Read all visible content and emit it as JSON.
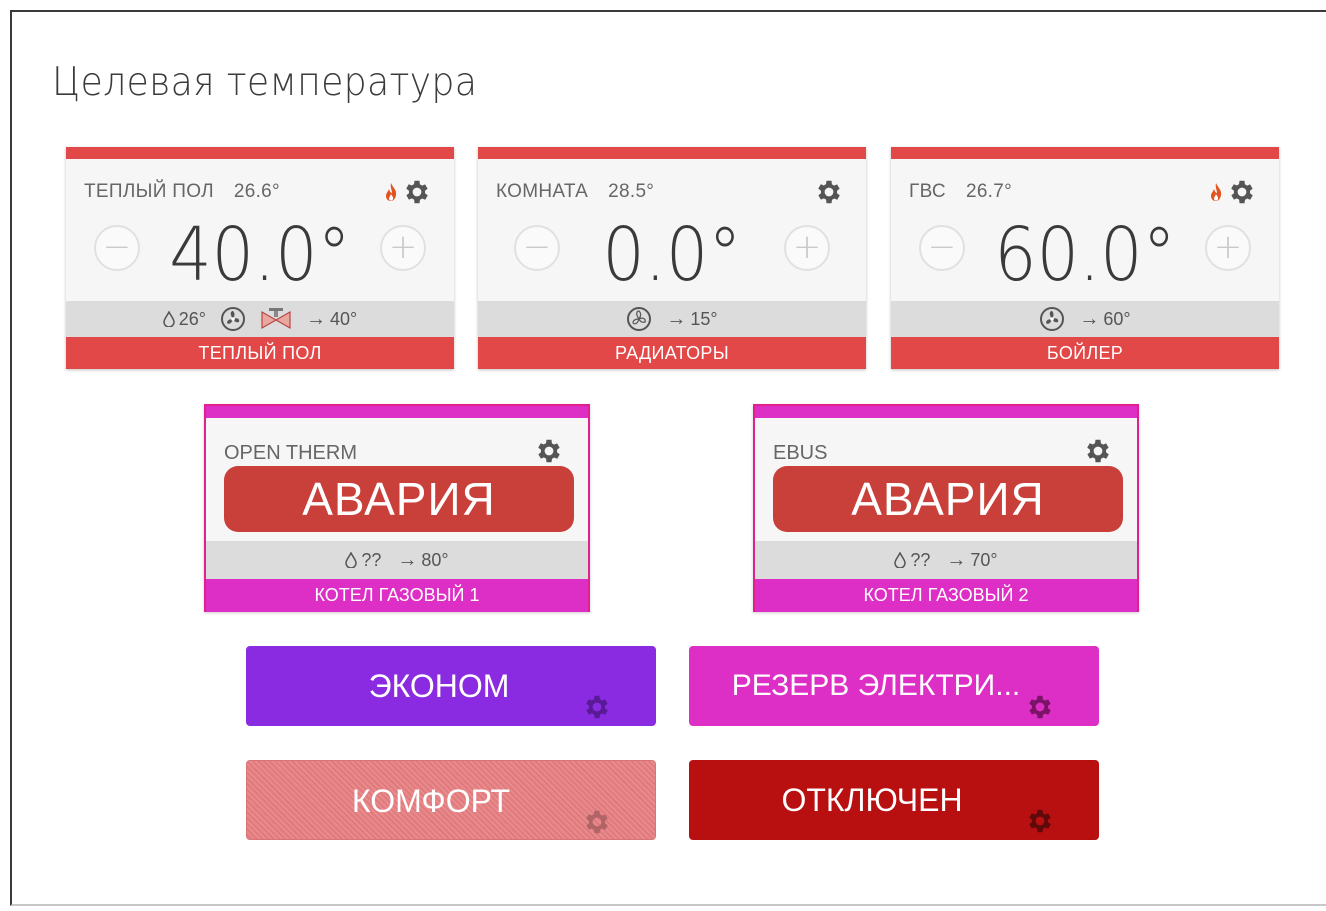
{
  "page": {
    "title": "Целевая температура"
  },
  "thermostats": [
    {
      "name": "ТЕПЛЫЙ ПОЛ",
      "current_temp": "26.6°",
      "setpoint": "40.0°",
      "minus": "−",
      "plus": "+",
      "drop_value": "26°",
      "arrow_value": "40°",
      "footer": "ТЕПЛЫЙ ПОЛ"
    },
    {
      "name": "КОМНАТА",
      "current_temp": "28.5°",
      "setpoint": "0.0°",
      "minus": "−",
      "plus": "+",
      "arrow_value": "15°",
      "footer": "РАДИАТОРЫ"
    },
    {
      "name": "ГВС",
      "current_temp": "26.7°",
      "setpoint": "60.0°",
      "minus": "−",
      "plus": "+",
      "arrow_value": "60°",
      "footer": "БОЙЛЕР"
    }
  ],
  "boilers": [
    {
      "name": "OPEN THERM",
      "status": "АВАРИЯ",
      "drop_value": "??",
      "arrow_value": "80°",
      "footer": "КОТЕЛ ГАЗОВЫЙ 1"
    },
    {
      "name": "EBUS",
      "status": "АВАРИЯ",
      "drop_value": "??",
      "arrow_value": "70°",
      "footer": "КОТЕЛ ГАЗОВЫЙ 2"
    }
  ],
  "modes": {
    "econom": "ЭКОНОМ",
    "reserve": "РЕЗЕРВ ЭЛЕКТРИ...",
    "comfort": "КОМФОРТ",
    "off": "ОТКЛЮЧЕН"
  },
  "colors": {
    "card_accent": "#e34848",
    "boiler_accent": "#dd2fc5",
    "alarm": "#c9403a",
    "econom": "#8a2be2",
    "reserve": "#dd2fc5",
    "comfort": "#e98a8c",
    "off": "#b80f10"
  }
}
